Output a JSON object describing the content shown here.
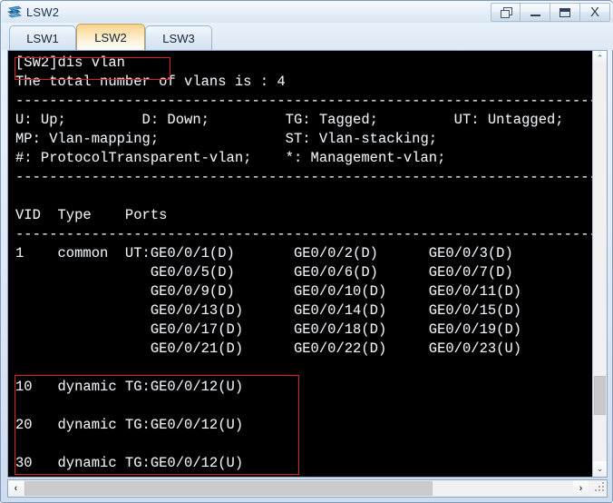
{
  "window": {
    "title": "LSW2",
    "icon": "switch-icon",
    "buttons": [
      {
        "name": "restore-window-button",
        "glyph": "restore"
      },
      {
        "name": "minimize-window-button",
        "glyph": "minimize"
      },
      {
        "name": "maximize-window-button",
        "glyph": "maximize"
      },
      {
        "name": "close-window-button",
        "glyph": "close",
        "label": "X"
      }
    ]
  },
  "tabs": {
    "items": [
      {
        "label": "LSW1",
        "active": false
      },
      {
        "label": "LSW2",
        "active": true
      },
      {
        "label": "LSW3",
        "active": false
      }
    ]
  },
  "terminal": {
    "command": "[SW2]dis vlan",
    "content": "[SW2]dis vlan\nThe total number of vlans is : 4\n--------------------------------------------------------------------------------\nU: Up;         D: Down;         TG: Tagged;         UT: Untagged;\nMP: Vlan-mapping;               ST: Vlan-stacking;\n#: ProtocolTransparent-vlan;    *: Management-vlan;\n--------------------------------------------------------------------------------\n\nVID  Type    Ports\n--------------------------------------------------------------------------------\n1    common  UT:GE0/0/1(D)       GE0/0/2(D)      GE0/0/3(D)\n                GE0/0/5(D)       GE0/0/6(D)      GE0/0/7(D)\n                GE0/0/9(D)       GE0/0/10(D)     GE0/0/11(D)\n                GE0/0/13(D)      GE0/0/14(D)     GE0/0/15(D)\n                GE0/0/17(D)      GE0/0/18(D)     GE0/0/19(D)\n                GE0/0/21(D)      GE0/0/22(D)     GE0/0/23(U)\n\n10   dynamic TG:GE0/0/12(U)\n\n20   dynamic TG:GE0/0/12(U)\n\n30   dynamic TG:GE0/0/12(U)",
    "vlan_total_line": "The total number of vlans is : 4",
    "legend": {
      "up": "U: Up;",
      "down": "D: Down;",
      "tagged": "TG: Tagged;",
      "untagged": "UT: Untagged;",
      "vlan_mapping": "MP: Vlan-mapping;",
      "vlan_stacking": "ST: Vlan-stacking;",
      "protocol_transparent": "#: ProtocolTransparent-vlan;",
      "management": "*: Management-vlan;"
    },
    "table_headers": [
      "VID",
      "Type",
      "Ports"
    ],
    "vlans": [
      {
        "vid": "1",
        "type": "common",
        "tag": "UT",
        "ports": [
          "GE0/0/1(D)",
          "GE0/0/2(D)",
          "GE0/0/3(D)",
          "GE0/0/5(D)",
          "GE0/0/6(D)",
          "GE0/0/7(D)",
          "GE0/0/9(D)",
          "GE0/0/10(D)",
          "GE0/0/11(D)",
          "GE0/0/13(D)",
          "GE0/0/14(D)",
          "GE0/0/15(D)",
          "GE0/0/17(D)",
          "GE0/0/18(D)",
          "GE0/0/19(D)",
          "GE0/0/21(D)",
          "GE0/0/22(D)",
          "GE0/0/23(U)"
        ]
      },
      {
        "vid": "10",
        "type": "dynamic",
        "tag": "TG",
        "ports": [
          "GE0/0/12(U)"
        ]
      },
      {
        "vid": "20",
        "type": "dynamic",
        "tag": "TG",
        "ports": [
          "GE0/0/12(U)"
        ]
      },
      {
        "vid": "30",
        "type": "dynamic",
        "tag": "TG",
        "ports": [
          "GE0/0/12(U)"
        ]
      }
    ]
  },
  "annotations": {
    "command_highlight_color": "#e02020",
    "vlan_highlight_color": "#e02020"
  },
  "scrollbars": {
    "vertical": {
      "up_arrow": "⌃",
      "down_arrow": "⌄"
    },
    "horizontal": {
      "left_arrow": "‹",
      "right_arrow": "›"
    }
  },
  "colors": {
    "terminal_bg": "#000000",
    "terminal_fg": "#f1f1f1",
    "accent_tab": "#f8d48a",
    "frame": "#7a99bd"
  }
}
